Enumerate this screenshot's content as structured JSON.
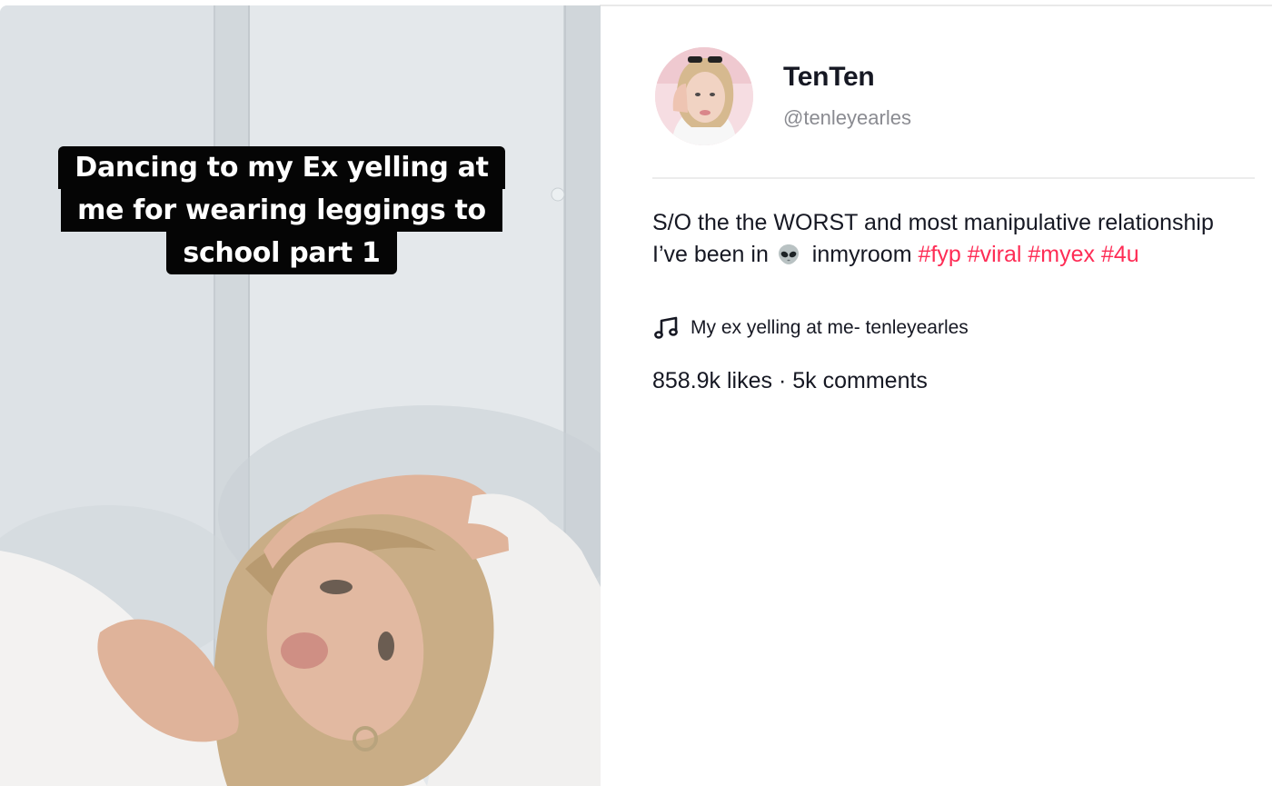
{
  "video": {
    "caption_lines": [
      "Dancing to my Ex yelling at",
      "me for wearing leggings to",
      "school part 1"
    ]
  },
  "author": {
    "display_name": "TenTen",
    "username": "@tenleyearles",
    "avatar_icon": "profile-photo"
  },
  "description": {
    "text_line": "S/O the the WORST and most manipulative relationship I’ve been in",
    "emoji_icon": "alien-emoji-icon",
    "after_emoji": "inmyroom",
    "hashtags": [
      "#fyp",
      "#viral",
      "#myex",
      "#4u"
    ]
  },
  "music": {
    "icon": "music-note-icon",
    "title": "My ex yelling at me- tenleyearles"
  },
  "stats": {
    "likes": "858.9k likes",
    "separator": "·",
    "comments": "5k comments"
  },
  "colors": {
    "hashtag": "#fe2c55",
    "text": "#161823",
    "muted": "#8a8b91",
    "caption_bg": "#050505"
  }
}
